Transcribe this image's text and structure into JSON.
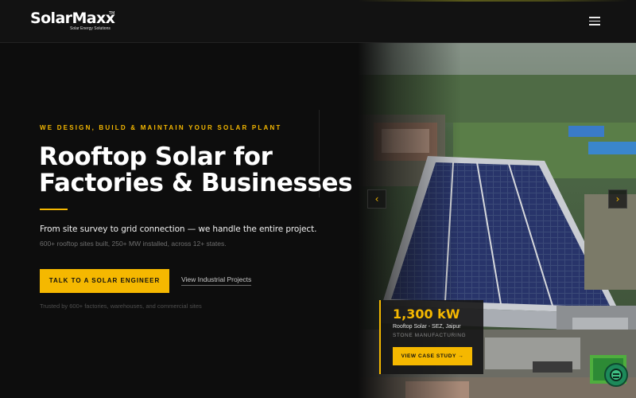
{
  "brand": {
    "name": "SolarMaxx",
    "trademark": "TM",
    "tagline": "Solar Energy Solutions"
  },
  "header": {
    "menu_icon": "hamburger-menu-icon"
  },
  "hero": {
    "eyebrow": "WE DESIGN, BUILD & MAINTAIN YOUR SOLAR PLANT",
    "headline_line1": "Rooftop Solar for",
    "headline_line2": "Factories & Businesses",
    "subhead": "From site survey to grid connection — we handle the entire project.",
    "stats": "600+ rooftop sites built, 250+ MW installed, across 12+ states.",
    "cta_label": "TALK TO A SOLAR ENGINEER",
    "secondary_link": "View Industrial Projects",
    "trust_line": "Trusted by 600+ factories, warehouses, and commercial sites"
  },
  "carousel": {
    "prev_icon": "chevron-left-icon",
    "prev_glyph": "‹",
    "next_icon": "chevron-right-icon",
    "next_glyph": "›"
  },
  "case_study": {
    "capacity": "1,300 kW",
    "location": "Rooftop Solar - SEZ, Jaipur",
    "client": "STONE MANUFACTURING",
    "button_label": "VIEW CASE STUDY →"
  },
  "chat": {
    "icon": "chat-icon"
  },
  "colors": {
    "accent": "#f5b800",
    "background": "#0d0d0d",
    "header": "#121212"
  }
}
